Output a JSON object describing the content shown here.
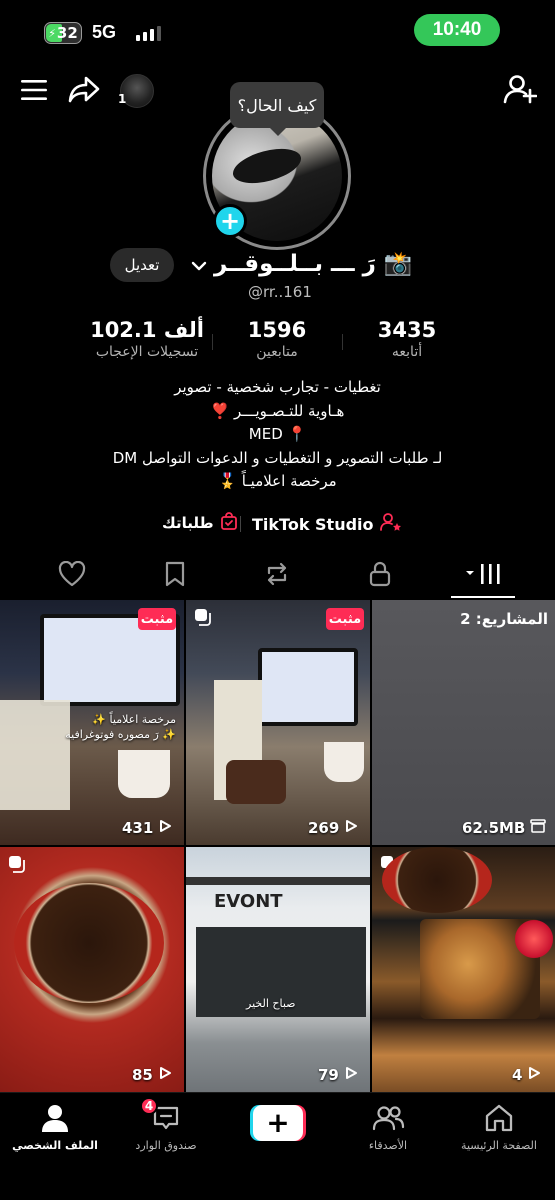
{
  "status": {
    "battery": "32",
    "network": "5G",
    "time": "10:40"
  },
  "header": {
    "story_count": "1"
  },
  "profile": {
    "bubble": "كيف الحال؟",
    "edit_label": "تعديل",
    "display_name": "رَ ـــ بــلــوقــر 📸",
    "username": "@rr..161"
  },
  "stats": [
    {
      "value": "3435",
      "label": "أتابعه"
    },
    {
      "value": "1596",
      "label": "متابعين"
    },
    {
      "value": "102.1 ألف",
      "label": "تسجيلات الإعجاب"
    }
  ],
  "bio": [
    "تغطيات - تجارب شخصية - تصوير",
    "هـاوية للتـصـويـــر ❣️",
    "MED 📍",
    "لـ طلبات التصوير و التغطيات و الدعوات التواصل DM",
    "مرخصة اعلاميـاً 🎖️"
  ],
  "links": {
    "orders": "طلباتك",
    "studio": "TikTok Studio"
  },
  "grid": [
    {
      "count": "431",
      "pinned": "مثبت",
      "caption": "مرخصة اعلامياً ✨ \n ✨ رَ مصوره فوتوغرافيه"
    },
    {
      "count": "269",
      "pinned": "مثبت"
    },
    {
      "projects": "المشاريع: 2",
      "size": "62.5MB"
    },
    {
      "count": "85"
    },
    {
      "count": "79",
      "sign": "EVONT",
      "caption": "صباح الخير"
    },
    {
      "count": "4"
    }
  ],
  "nav": {
    "home": "الصفحة الرئيسية",
    "friends": "الأصدقاء",
    "create": "+",
    "inbox": "صندوق الوارد",
    "inbox_badge": "4",
    "profile": "الملف الشخصي"
  },
  "colors": {
    "accent": "#fe2c55",
    "cyan": "#20d5ec",
    "status_green": "#34c759"
  }
}
